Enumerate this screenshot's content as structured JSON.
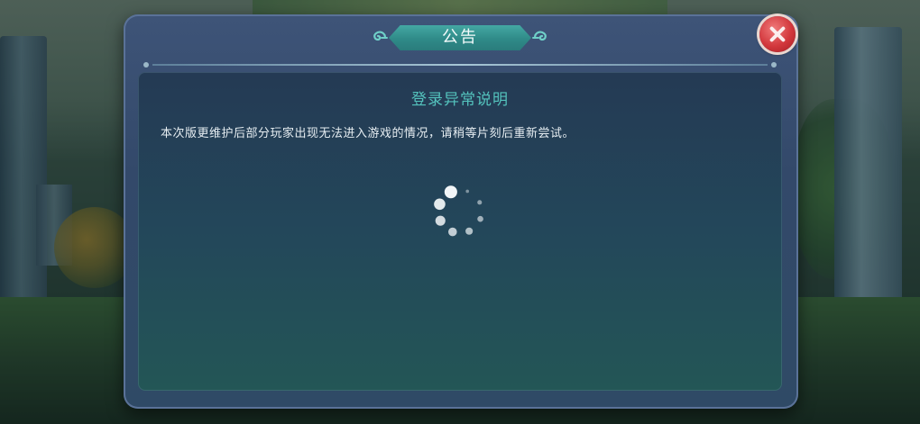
{
  "dialog": {
    "title": "公告",
    "heading": "登录异常说明",
    "body": "本次版更维护后部分玩家出现无法进入游戏的情况，请稍等片刻后重新尝试。"
  },
  "close_button": {
    "icon": "close-icon"
  },
  "loading": {
    "icon": "loading-spinner-icon",
    "dot_count": 8
  },
  "colors": {
    "dialog_frame": "#3e5478",
    "title_plate": "#3a9a97",
    "heading": "#54c3bd",
    "body_text": "#e7eef2",
    "close_button": "#d2373c"
  }
}
